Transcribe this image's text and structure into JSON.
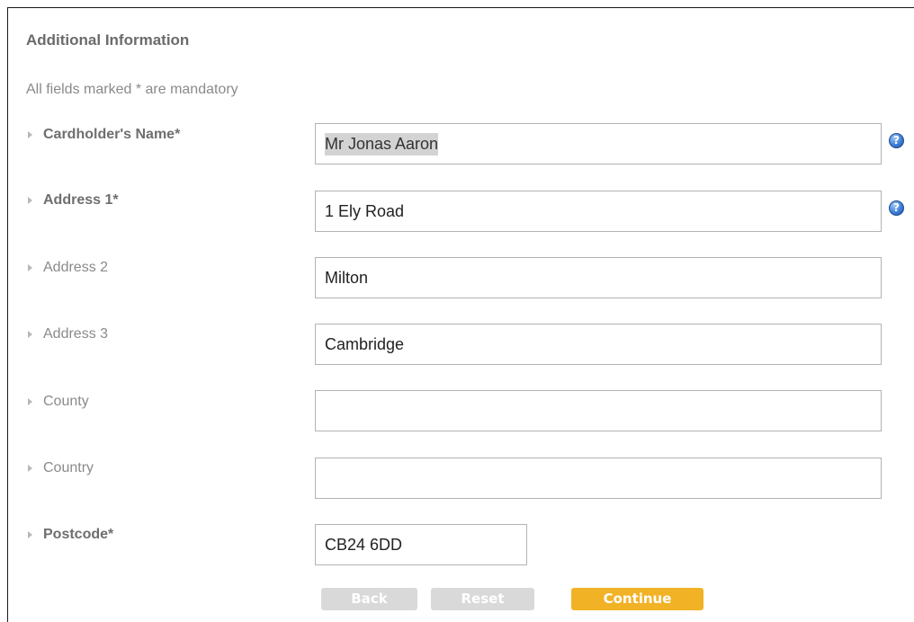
{
  "section": {
    "title": "Additional Information",
    "mandatory_note": "All fields marked * are mandatory"
  },
  "fields": [
    {
      "label": "Cardholder's Name*",
      "value": "Mr Jonas Aaron",
      "required": true,
      "help_icon": "question-icon"
    },
    {
      "label": "Address 1*",
      "value": "1 Ely Road",
      "required": true,
      "help_icon": "question-icon"
    },
    {
      "label": "Address 2",
      "value": "Milton",
      "required": false
    },
    {
      "label": "Address 3",
      "value": "Cambridge",
      "required": false
    },
    {
      "label": "County",
      "value": "",
      "required": false
    },
    {
      "label": "Country",
      "value": "",
      "required": false
    },
    {
      "label": "Postcode*",
      "value": "CB24 6DD",
      "required": true
    }
  ],
  "buttons": {
    "back": "Back",
    "reset": "Reset",
    "continue": "Continue"
  },
  "colors": {
    "continue_button": "#f2b226",
    "disabled_button": "#d9d9d9",
    "help_icon": "#3f7fd6"
  }
}
